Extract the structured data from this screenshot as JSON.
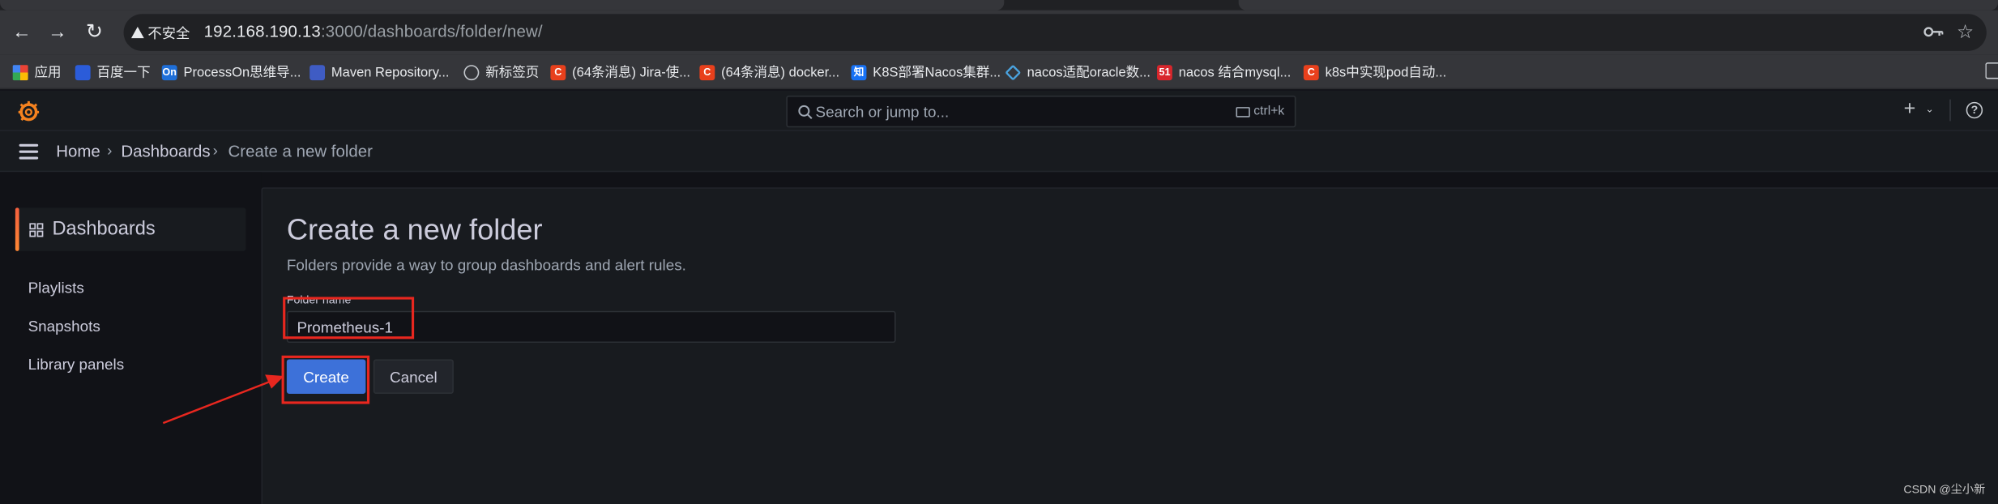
{
  "browser": {
    "back_icon": "←",
    "forward_icon": "→",
    "reload_icon": "↻",
    "security_label": "不安全",
    "url_host": "192.168.190.13",
    "url_rest": ":3000/dashboards/folder/new/",
    "key_icon": "key-icon",
    "star_icon": "☆",
    "bookmarks": [
      {
        "label": "应用",
        "icon": "apps-grid-icon",
        "color": "#ea4335"
      },
      {
        "label": "百度一下",
        "icon": "baidu-icon",
        "color": "#2b5cd9"
      },
      {
        "label": "ProcessOn思维导...",
        "icon": "processon-icon",
        "color": "#1e6fd9",
        "glyph": "On"
      },
      {
        "label": "Maven Repository...",
        "icon": "maven-icon",
        "color": "#3f5cc4"
      },
      {
        "label": "新标签页",
        "icon": "globe-icon",
        "color": "#c5c9ce"
      },
      {
        "label": "(64条消息) Jira-使...",
        "icon": "csdn-icon",
        "color": "#e8401c",
        "glyph": "C"
      },
      {
        "label": "(64条消息) docker...",
        "icon": "csdn-icon",
        "color": "#e8401c",
        "glyph": "C"
      },
      {
        "label": "K8S部署Nacos集群...",
        "icon": "zhihu-icon",
        "color": "#1772f6",
        "glyph": "知"
      },
      {
        "label": "nacos适配oracle数...",
        "icon": "nacos-icon",
        "color": "#4aa3df"
      },
      {
        "label": "nacos 结合mysql...",
        "icon": "51cto-icon",
        "color": "#d8262c",
        "glyph": "51"
      },
      {
        "label": "k8s中实现pod自动...",
        "icon": "csdn-icon",
        "color": "#e8401c",
        "glyph": "C"
      }
    ]
  },
  "grafana": {
    "search_placeholder": "Search or jump to...",
    "search_shortcut": "ctrl+k",
    "plus_icon": "+",
    "chevron_icon": "⌄",
    "help_icon": "?",
    "breadcrumb": [
      "Home",
      "Dashboards",
      "Create a new folder"
    ],
    "breadcrumb_sep": "›",
    "sidebar": {
      "section": "Dashboards",
      "items": [
        "Playlists",
        "Snapshots",
        "Library panels"
      ]
    },
    "page": {
      "title": "Create a new folder",
      "subtitle": "Folders provide a way to group dashboards and alert rules.",
      "field_label": "Folder name",
      "field_value": "Prometheus-1",
      "create_label": "Create",
      "cancel_label": "Cancel"
    }
  },
  "annotation_color": "#e8271f",
  "accent_color": "#3d71d9",
  "watermark": "CSDN @尘小新"
}
